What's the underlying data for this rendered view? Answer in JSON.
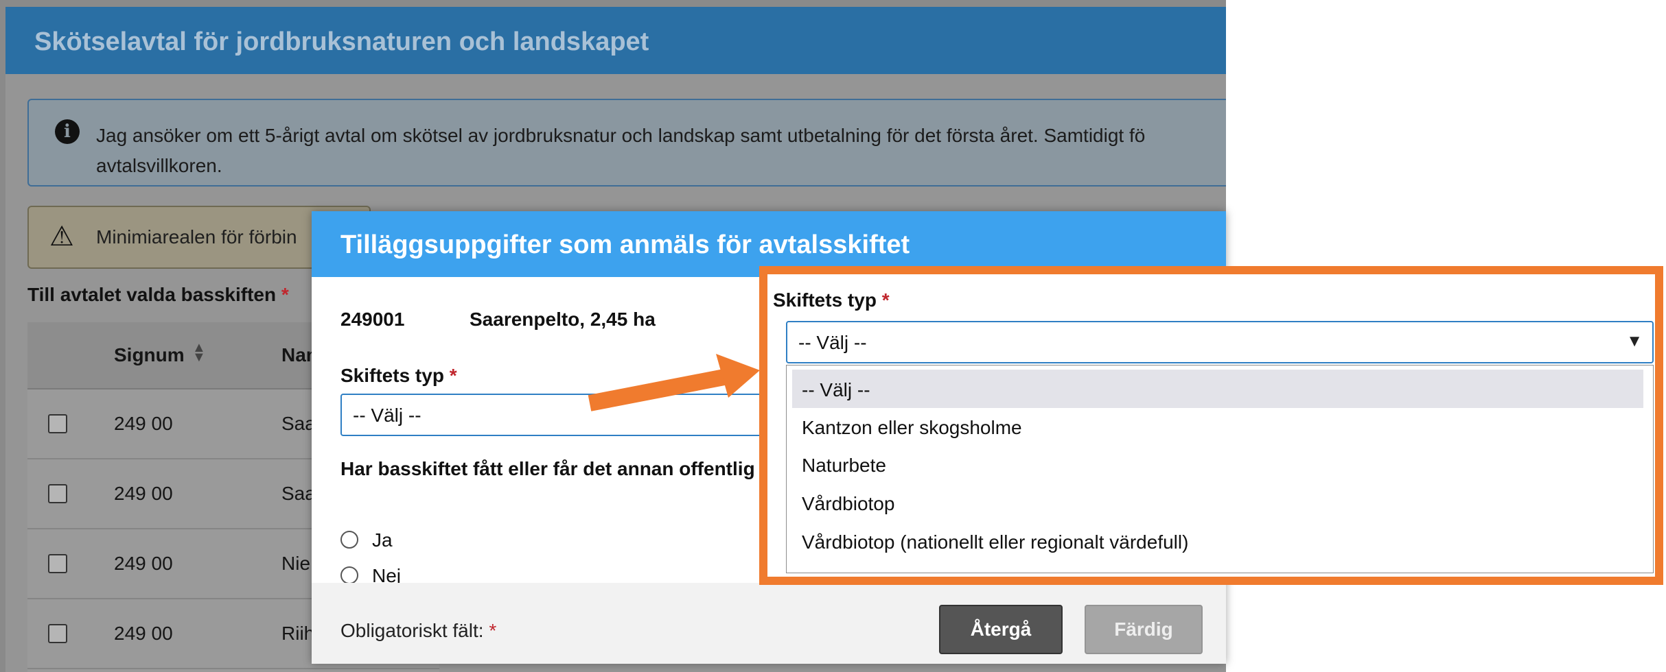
{
  "background": {
    "title": "Skötselavtal för jordbruksnaturen och landskapet",
    "info_text": "Jag ansöker om ett 5-årigt avtal om skötsel av jordbruksnatur och landskap samt utbetalning för det första året. Samtidigt fö\navtalsvillkoren.",
    "warning_text": "Minimiarealen för förbin",
    "selected_label": "Till avtalet valda basskiften",
    "table": {
      "headers": [
        "Signum",
        "Nam"
      ],
      "rows": [
        {
          "signum": "249 00",
          "name": "Saa"
        },
        {
          "signum": "249 00",
          "name": "Saa"
        },
        {
          "signum": "249 00",
          "name": "Nie"
        },
        {
          "signum": "249 00",
          "name": "Riih"
        }
      ]
    }
  },
  "modal": {
    "title": "Tilläggsuppgifter som anmäls för avtalsskiftet",
    "parcel_code": "249001",
    "parcel_name": "Saarenpelto, 2,45 ha",
    "type_label": "Skiftets typ",
    "required_mark": "*",
    "select_value": "-- Välj --",
    "question": "Har basskiftet fått eller får det annan offentlig",
    "radios": [
      "Ja",
      "Nej"
    ],
    "required_note": "Obligatoriskt fält:",
    "buttons": {
      "back": "Återgå",
      "done": "Färdig"
    }
  },
  "callout": {
    "label": "Skiftets typ",
    "select_value": "-- Välj --",
    "options": [
      "-- Välj --",
      "Kantzon eller skogsholme",
      "Naturbete",
      "Vårdbiotop",
      "Vårdbiotop (nationellt eller regionalt värdefull)"
    ],
    "selected_index": 0
  },
  "icons": {
    "info": "info-circle-icon",
    "warning": "warning-triangle-icon",
    "sort": "sort-icon",
    "caret": "chevron-down-icon"
  },
  "colors": {
    "modal_header": "#3da2ee",
    "page_header": "#2a6fa4",
    "callout_border": "#f07b2e",
    "required": "#c0262d"
  }
}
